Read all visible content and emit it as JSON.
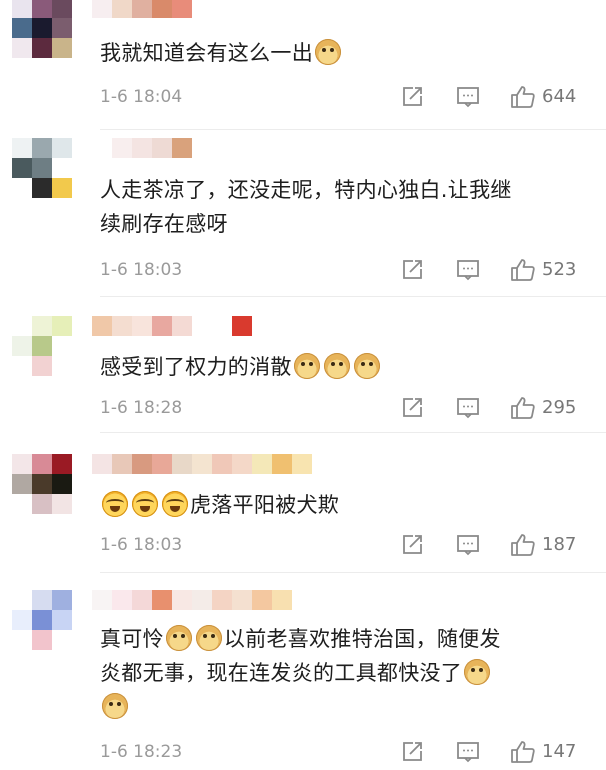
{
  "comments": [
    {
      "lines": [
        [
          "我就知道会有这么一出",
          "doge"
        ]
      ],
      "time": "1-6 18:04",
      "likes": "644"
    },
    {
      "lines": [
        [
          "人走茶凉了，还没走呢，特内心独白.让我继"
        ],
        [
          "续刷存在感呀"
        ]
      ],
      "time": "1-6 18:03",
      "likes": "523"
    },
    {
      "lines": [
        [
          "感受到了权力的消散",
          "doge",
          "doge",
          "doge"
        ]
      ],
      "time": "1-6 18:28",
      "likes": "295"
    },
    {
      "lines": [
        [
          "cry",
          "cry",
          "cry",
          "虎落平阳被犬欺"
        ]
      ],
      "time": "1-6 18:03",
      "likes": "187"
    },
    {
      "lines": [
        [
          "真可怜",
          "doge",
          "doge",
          "以前老喜欢推特治国，随便发"
        ],
        [
          "炎都无事，现在连发炎的工具都快没了",
          "doge"
        ],
        [
          "doge"
        ]
      ],
      "time": "1-6 18:23",
      "likes": "147"
    }
  ],
  "icons": {
    "share": "share-icon",
    "comment": "comment-icon",
    "like": "thumbs-up-icon"
  },
  "colors": {
    "meta_text": "#9a9a9a",
    "divider": "#ececec",
    "body_text": "#1e1e1e"
  }
}
